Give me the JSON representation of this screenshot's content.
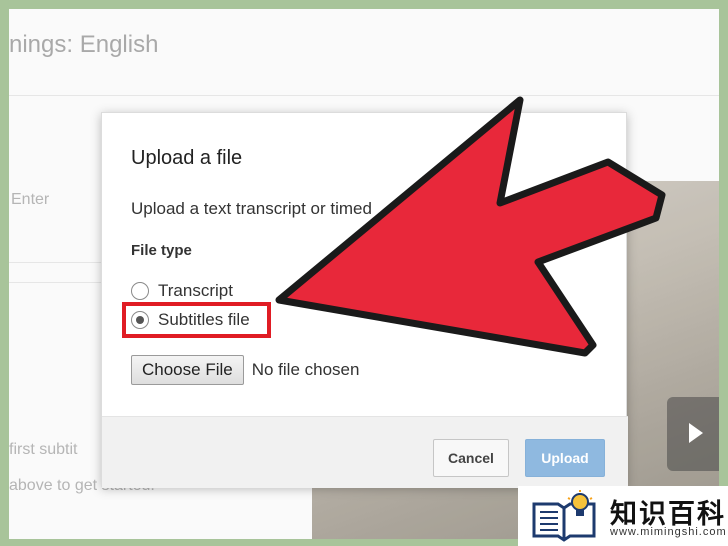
{
  "background": {
    "title": "nings: English",
    "enter_hint": "Enter",
    "subtitle_hint_1": "first subtit",
    "subtitle_hint_2": "above to get started."
  },
  "dialog": {
    "title": "Upload a file",
    "description": "Upload a text transcript or timed",
    "file_type_label": "File type",
    "options": [
      {
        "label": "Transcript",
        "selected": false
      },
      {
        "label": "Subtitles file",
        "selected": true
      }
    ],
    "choose_file_label": "Choose File",
    "no_file_text": "No file chosen",
    "cancel_label": "Cancel",
    "upload_label": "Upload"
  },
  "watermark": {
    "brand": "知识百科",
    "url": "www.mimingshi.com"
  },
  "colors": {
    "arrow": "#e8283a",
    "highlight": "#e01c24",
    "upload_button": "#8fb9e0",
    "frame": "#a8c49a"
  },
  "icons": [
    "play-icon",
    "book-lightbulb-icon"
  ]
}
